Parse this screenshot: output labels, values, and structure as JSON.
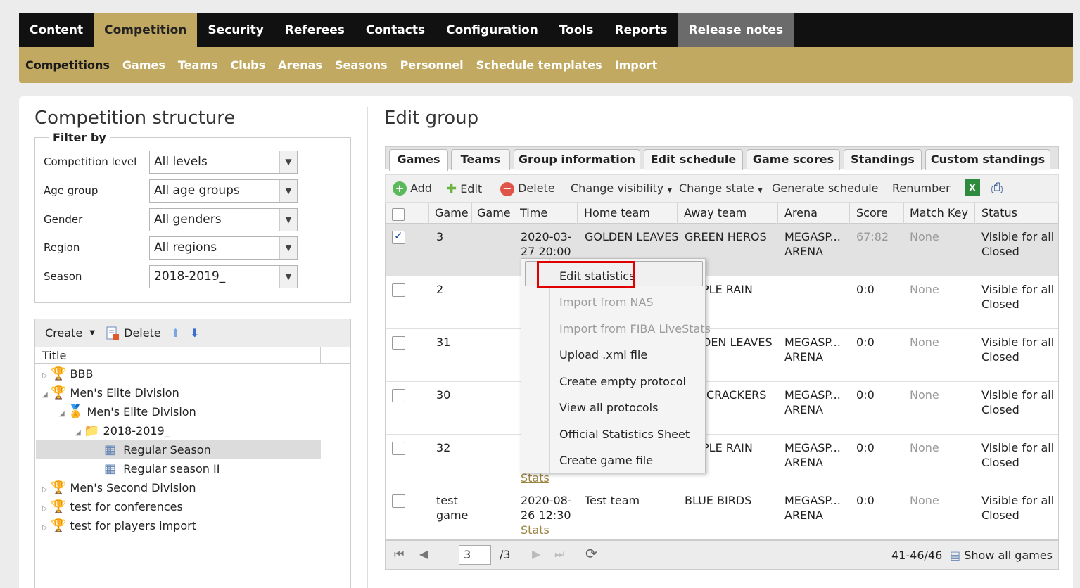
{
  "topnav": [
    "Content",
    "Competition",
    "Security",
    "Referees",
    "Contacts",
    "Configuration",
    "Tools",
    "Reports",
    "Release notes"
  ],
  "subnav": [
    "Competitions",
    "Games",
    "Teams",
    "Clubs",
    "Arenas",
    "Seasons",
    "Personnel",
    "Schedule templates",
    "Import"
  ],
  "left": {
    "title": "Competition structure",
    "filter_legend": "Filter by",
    "filters": [
      {
        "label": "Competition level",
        "value": "All levels"
      },
      {
        "label": "Age group",
        "value": "All age groups"
      },
      {
        "label": "Gender",
        "value": "All genders"
      },
      {
        "label": "Region",
        "value": "All regions"
      },
      {
        "label": "Season",
        "value": "2018-2019_"
      }
    ],
    "tree_toolbar": {
      "create": "Create",
      "delete": "Delete"
    },
    "tree_header": "Title",
    "tree": [
      "BBB",
      "Men's Elite Division",
      "Men's Elite Division",
      "2018-2019_",
      "Regular Season",
      "Regular season II",
      "Men's Second Division",
      "test for conferences",
      "test for players import"
    ]
  },
  "right": {
    "title": "Edit group",
    "tabs": [
      "Games",
      "Teams",
      "Group information",
      "Edit schedule",
      "Game scores",
      "Standings",
      "Custom standings"
    ],
    "toolbar": {
      "add": "Add",
      "edit": "Edit",
      "delete": "Delete",
      "change_visibility": "Change visibility",
      "change_state": "Change state",
      "generate_schedule": "Generate schedule",
      "renumber": "Renumber"
    },
    "columns": [
      "Game",
      "Game",
      "Time",
      "Home team",
      "Away team",
      "Arena",
      "Score",
      "Match Key",
      "Status"
    ],
    "rows": [
      {
        "game": "3",
        "game2": "",
        "time1": "2020-03-",
        "time2": "27 20:00",
        "stats": "",
        "home": "GOLDEN LEAVES",
        "away": "GREEN HEROS",
        "arena1": "MEGASP...",
        "arena2": "ARENA",
        "score": "67:82",
        "key": "None",
        "status1": "Visible for all",
        "status2": "Closed"
      },
      {
        "game": "2",
        "game2": "",
        "time1": "",
        "time2": "",
        "stats": "",
        "home": "",
        "away": "PLE RAIN",
        "arena1": "",
        "arena2": "",
        "score": "0:0",
        "key": "None",
        "status1": "Visible for all",
        "status2": "Closed"
      },
      {
        "game": "31",
        "game2": "",
        "time1": "",
        "time2": "",
        "stats": "",
        "home": "",
        "away": "DEN LEAVES",
        "arena1": "MEGASP...",
        "arena2": "ARENA",
        "score": "0:0",
        "key": "None",
        "status1": "Visible for all",
        "status2": "Closed"
      },
      {
        "game": "30",
        "game2": "",
        "time1": "",
        "time2": "",
        "stats": "",
        "home": "",
        "away": "CRACKERS",
        "arena1": "MEGASP...",
        "arena2": "ARENA",
        "score": "0:0",
        "key": "None",
        "status1": "Visible for all",
        "status2": "Closed"
      },
      {
        "game": "32",
        "game2": "",
        "time1": "",
        "time2": "",
        "stats": "Stats",
        "home": "",
        "away": "PLE RAIN",
        "arena1": "MEGASP...",
        "arena2": "ARENA",
        "score": "0:0",
        "key": "None",
        "status1": "Visible for all",
        "status2": "Closed"
      },
      {
        "game": "test",
        "game2": "game",
        "time1": "2020-08-",
        "time2": "26 12:30",
        "stats": "Stats",
        "home": "Test team",
        "away": "BLUE BIRDS",
        "arena1": "MEGASP...",
        "arena2": "ARENA",
        "score": "0:0",
        "key": "None",
        "status1": "Visible for all",
        "status2": "Closed"
      }
    ],
    "pager": {
      "page": "3",
      "total": "/3",
      "range": "41-46/46",
      "show_all": "Show all games"
    }
  },
  "context_menu": [
    "Edit statistics",
    "Import from NAS",
    "Import from FIBA LiveStats",
    "Upload .xml file",
    "Create empty protocol",
    "View all protocols",
    "Official Statistics Sheet",
    "Create game file"
  ],
  "colors": {
    "gold": "#c2a962",
    "nav_black": "#111111",
    "highlight_red": "#e00000"
  }
}
